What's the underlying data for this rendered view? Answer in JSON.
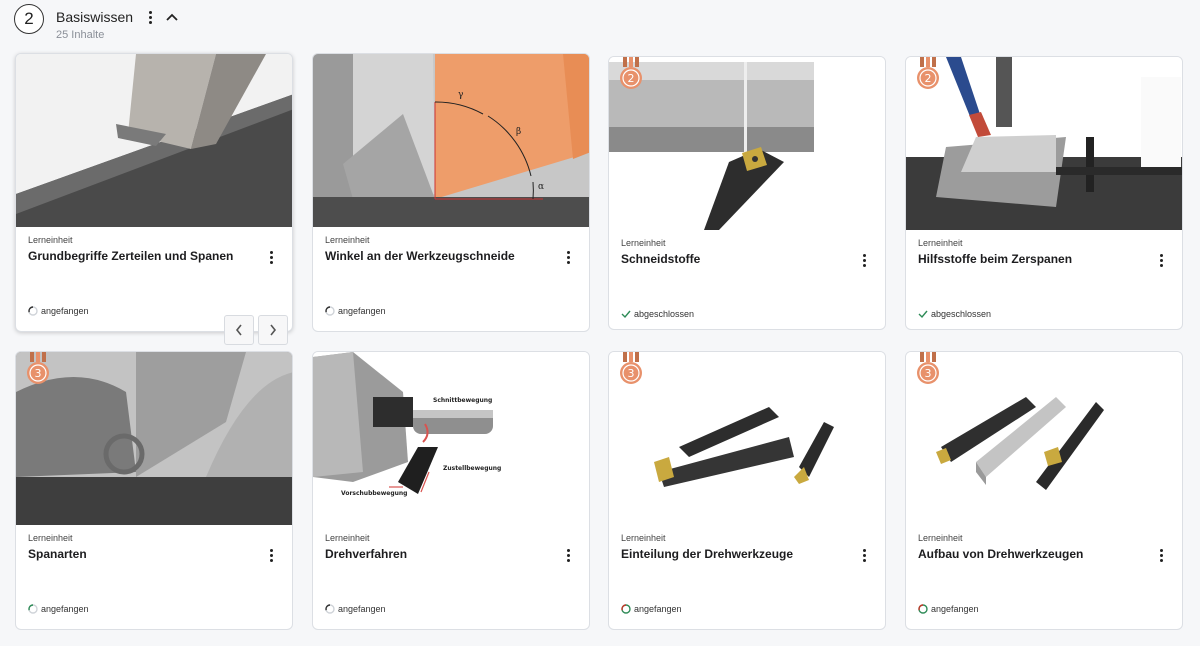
{
  "section": {
    "number": "2",
    "title": "Basiswissen",
    "count": "25 Inhalte"
  },
  "cards": [
    {
      "type": "Lerneinheit",
      "title": "Grundbegriffe Zerteilen und Spanen",
      "status": "angefangen"
    },
    {
      "type": "Lerneinheit",
      "title": "Winkel an der Werkzeugschneide",
      "status": "angefangen"
    },
    {
      "type": "Lerneinheit",
      "title": "Schneidstoffe",
      "status": "abgeschlossen",
      "medal": "2"
    },
    {
      "type": "Lerneinheit",
      "title": "Hilfsstoffe beim Zerspanen",
      "status": "abgeschlossen",
      "medal": "2"
    },
    {
      "type": "Lerneinheit",
      "title": "Spanarten",
      "status": "angefangen",
      "medal": "3"
    },
    {
      "type": "Lerneinheit",
      "title": "Drehverfahren",
      "status": "angefangen"
    },
    {
      "type": "Lerneinheit",
      "title": "Einteilung der Drehwerkzeuge",
      "status": "angefangen",
      "medal": "3"
    },
    {
      "type": "Lerneinheit",
      "title": "Aufbau von Drehwerkzeugen",
      "status": "angefangen",
      "medal": "3"
    }
  ],
  "image_labels": {
    "gamma": "γ",
    "beta": "β",
    "alpha": "α",
    "schnitt": "Schnittbewegung",
    "zustell": "Zustellbewegung",
    "vorschub": "Vorschubbewegung"
  },
  "colors": {
    "medal": "#e8916b",
    "progress_green": "#2e8b57",
    "progress_red": "#c0392b",
    "check": "#2e8b57"
  },
  "icons": {
    "menu": "vertical-dots-icon",
    "collapse": "chevron-up-icon",
    "prev": "chevron-left-icon",
    "next": "chevron-right-icon",
    "started": "progress-ring-icon",
    "done": "check-icon"
  }
}
